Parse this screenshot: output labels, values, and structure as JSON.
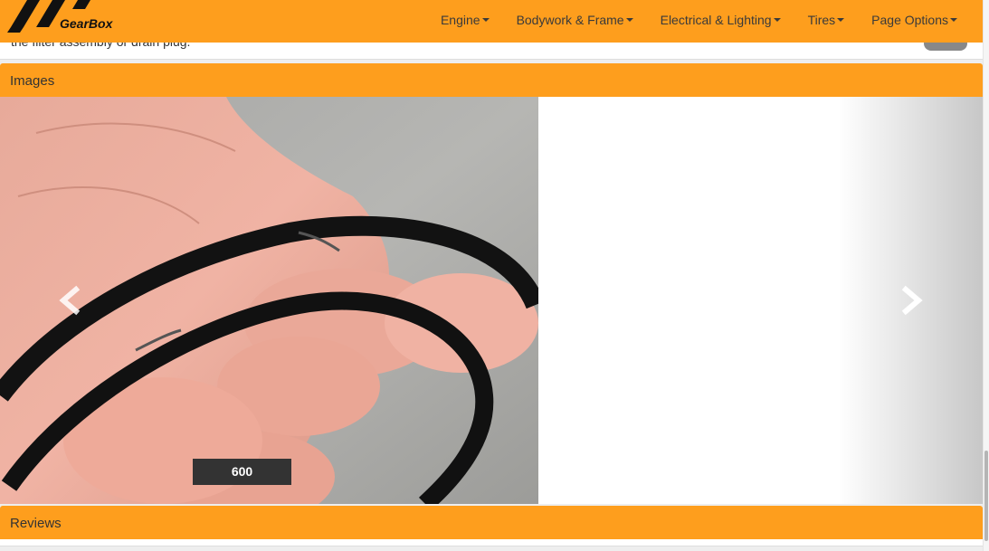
{
  "brand": {
    "name": "GearBox"
  },
  "nav": {
    "items": [
      {
        "label": "Engine"
      },
      {
        "label": "Bodywork & Frame"
      },
      {
        "label": "Electrical & Lighting"
      },
      {
        "label": "Tires"
      },
      {
        "label": "Page Options"
      }
    ]
  },
  "previous_section": {
    "text": "the filter assembly or drain plug."
  },
  "images_section": {
    "title": "Images",
    "carousel": {
      "image_description": "hand holding a cracked black rubber o-ring",
      "caption": "600",
      "prev_icon": "chevron-left-icon",
      "next_icon": "chevron-right-icon"
    }
  },
  "reviews_section": {
    "title": "Reviews"
  },
  "colors": {
    "accent": "#fe9e1d",
    "caption_bg": "#333333"
  }
}
